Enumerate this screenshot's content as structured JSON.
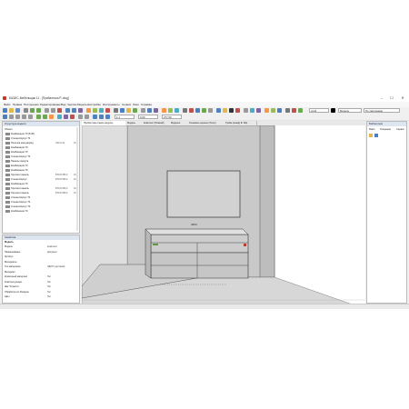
{
  "window": {
    "title": "БАЗИС-Мебельщик 11 - [Прибалтика Р.-dwg]"
  },
  "menu": [
    "Файл",
    "Правка",
    "Построения",
    "Редактирование",
    "Вид",
    "Чертёж",
    "Модель",
    "Настройки",
    "Инструменты",
    "Сервис",
    "Окно",
    "Справка"
  ],
  "toolbar": {
    "scale_value": "1:1",
    "coord_value": "0,00",
    "zoom_value": "277,00",
    "model_label": "Модель",
    "sheet_label": "По умолчанию",
    "layer_label": "слой"
  },
  "left_panel": {
    "title": "Структура модели",
    "root_label": "Объект",
    "rows": [
      {
        "label": "Комбинация 70 (8.30)",
        "val1": "",
        "val2": ""
      },
      {
        "label": "Стенка Корпус 70",
        "val1": "",
        "val2": ""
      },
      {
        "label": "Полочка ниж.разряд",
        "val1": "700,0×10",
        "val2": "16"
      },
      {
        "label": "Комбинация 70",
        "val1": "",
        "val2": ""
      },
      {
        "label": "Комбинация 70",
        "val1": "",
        "val2": ""
      },
      {
        "label": "Стенка Корпус 70",
        "val1": "",
        "val2": ""
      },
      {
        "label": "Панель корпуса",
        "val1": "",
        "val2": ""
      },
      {
        "label": "Комбинация 70",
        "val1": "",
        "val2": ""
      },
      {
        "label": "Комбинация 70",
        "val1": "",
        "val2": ""
      },
      {
        "label": "Горизонт.панель",
        "val1": "876,8×350,0",
        "val2": "16"
      },
      {
        "label": "Стенка Корпус",
        "val1": "876,8×350,0",
        "val2": "16"
      },
      {
        "label": "Комбинация 70",
        "val1": "",
        "val2": ""
      },
      {
        "label": "Горизонт.панель",
        "val1": "876,8×350,0",
        "val2": "16"
      },
      {
        "label": "Горизонт.панель",
        "val1": "876,8×350,0",
        "val2": "16"
      },
      {
        "label": "Стенка Корпус 70",
        "val1": "",
        "val2": ""
      },
      {
        "label": "Стенка Корпус 70",
        "val1": "",
        "val2": ""
      },
      {
        "label": "Стенка Корпус 70",
        "val1": "",
        "val2": ""
      },
      {
        "label": "Комбинация 70",
        "val1": "",
        "val2": ""
      }
    ]
  },
  "props_panel": {
    "title": "Свойства",
    "header_name": "Модель",
    "rows": [
      {
        "name": "Модель",
        "value": "Комплект"
      },
      {
        "name": "Наименование",
        "value": "Документ"
      },
      {
        "name": "Артикул",
        "value": ""
      },
      {
        "name": "Материалы",
        "value": ""
      },
      {
        "name": "Тип материала",
        "value": "ЛДСП (щитовой)"
      },
      {
        "name": "Материал",
        "value": ""
      },
      {
        "name": "Кромочный материал",
        "value": "Нет"
      },
      {
        "name": "Комплектующие",
        "value": "Нет"
      },
      {
        "name": "Шаг Точности",
        "value": "Нет"
      },
      {
        "name": "Обработка по Раскрою",
        "value": "Нет"
      },
      {
        "name": "Цвет",
        "value": "Нет"
      }
    ]
  },
  "viewport_tabs": [
    "Прибалтика (левое модуль)",
    "Модель",
    "Комплект (Нижний)",
    "Модель1",
    "Основное зеркало (Тело)",
    "Тумба (шкаф) Ф. 80р."
  ],
  "right_panel": {
    "title": "Библиотеки",
    "tabs": [
      "Файл",
      "Операции",
      "Сервис"
    ]
  },
  "dimension_label": "4800",
  "colors": {
    "accent": "#3a6ea5",
    "wall": "#c9c9c9",
    "floor": "#d7d7d7",
    "panel_head": "#dde6f0"
  }
}
